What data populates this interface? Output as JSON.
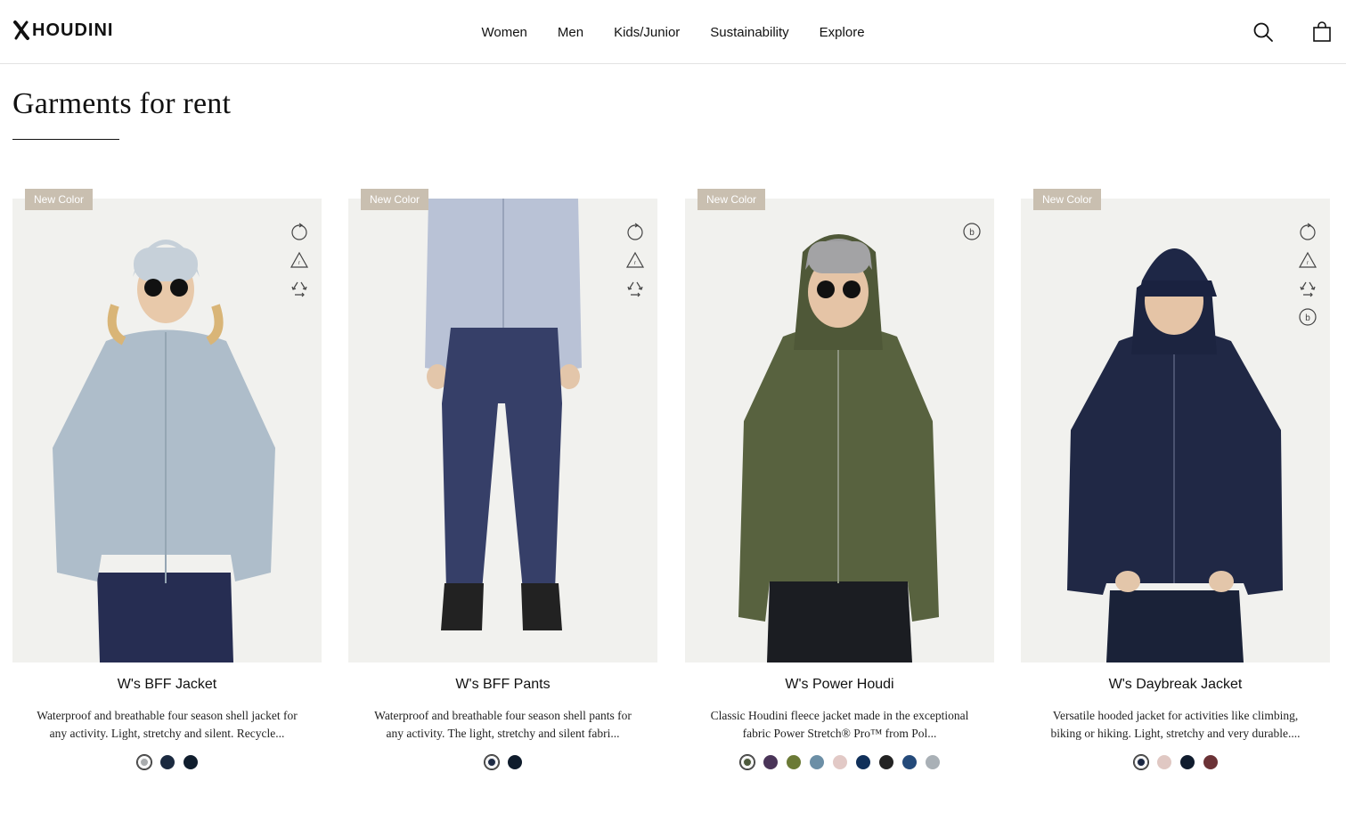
{
  "header": {
    "brand": "HOUDINI",
    "nav": [
      "Women",
      "Men",
      "Kids/Junior",
      "Sustainability",
      "Explore"
    ],
    "search_icon": "search-icon",
    "cart_icon": "shopping-bag-icon"
  },
  "page": {
    "title": "Garments for rent"
  },
  "colors": {
    "badge": "#c9bfb0",
    "card_bg": "#f1f1ee"
  },
  "products": [
    {
      "badge": "New Color",
      "name": "W's BFF Jacket",
      "description": "Waterproof and breathable four season shell jacket for any activity. Light, stretchy and silent. Recycle...",
      "icons": [
        "circular-icon",
        "recycled-icon",
        "recyclable-icon"
      ],
      "swatches": [
        "#a9acae",
        "#1b2a40",
        "#101e2e"
      ]
    },
    {
      "badge": "New Color",
      "name": "W's BFF Pants",
      "description": "Waterproof and breathable four season shell pants for any activity. The light, stretchy and silent fabri...",
      "icons": [
        "circular-icon",
        "recycled-icon",
        "recyclable-icon"
      ],
      "swatches": [
        "#1e2b45",
        "#0f1c2c"
      ]
    },
    {
      "badge": "New Color",
      "name": "W's Power Houdi",
      "description": "Classic Houdini fleece jacket made in the exceptional fabric Power Stretch® Pro™ from Pol...",
      "icons": [
        "bluesign-icon"
      ],
      "swatches": [
        "#4d5a3c",
        "#4a3458",
        "#6b7a36",
        "#6c8fa6",
        "#e2c9c6",
        "#10305a",
        "#232323",
        "#244a7a",
        "#a9b0b6"
      ]
    },
    {
      "badge": "New Color",
      "name": "W's Daybreak Jacket",
      "description": "Versatile hooded jacket for activities like climbing, biking or hiking. Light, stretchy and very durable....",
      "icons": [
        "circular-icon",
        "recycled-icon",
        "recyclable-icon",
        "bluesign-icon"
      ],
      "swatches": [
        "#1a2742",
        "#e0c8c3",
        "#101c2e",
        "#6b3236"
      ]
    }
  ]
}
